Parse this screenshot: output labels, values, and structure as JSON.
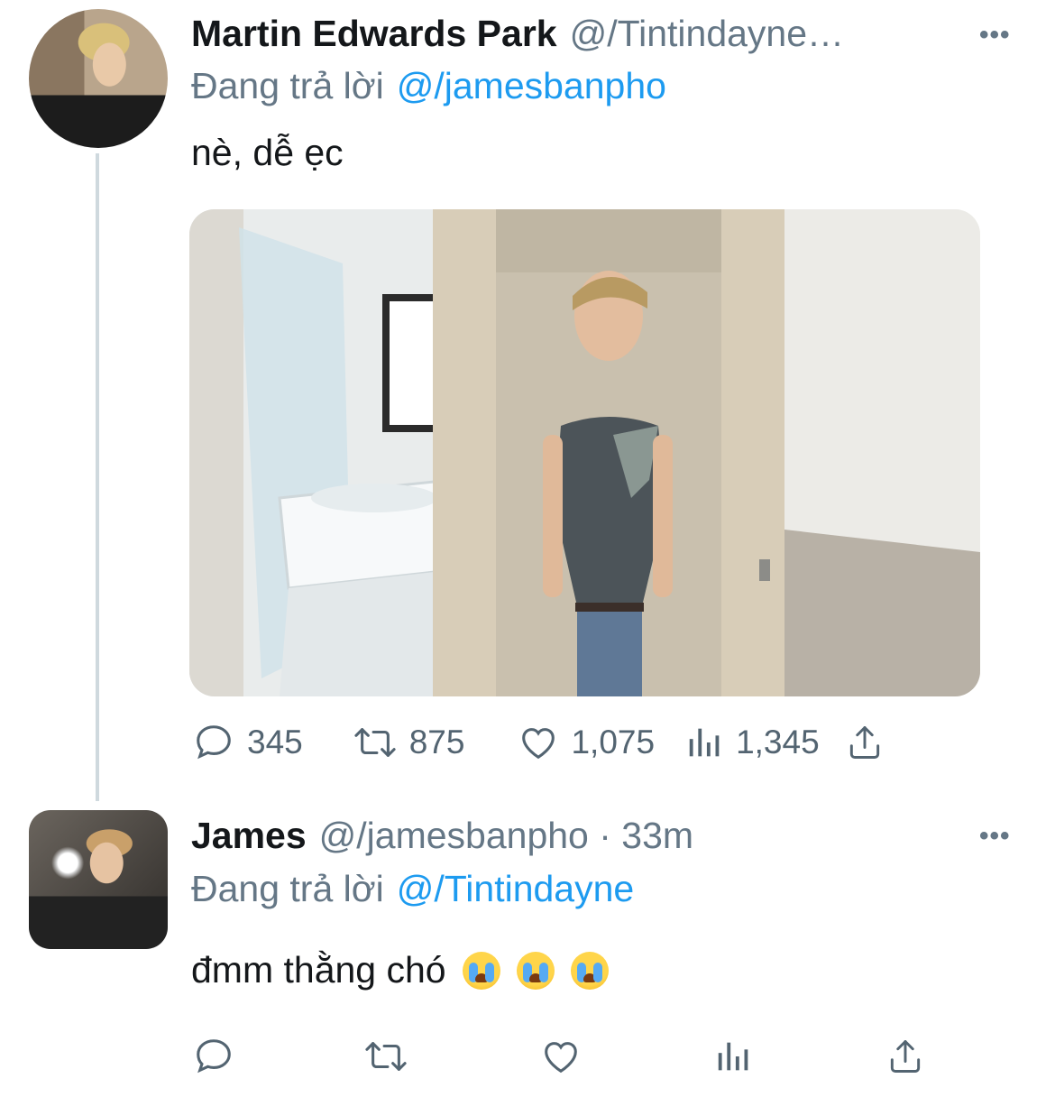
{
  "tweets": [
    {
      "name": "Martin Edwards Park",
      "handle": "@/Tintindayne…",
      "reply_prefix": "Đang trả lời",
      "reply_to": "@/jamesbanpho",
      "text": "nè, dễ ẹc",
      "more_icon": "•••",
      "stats": {
        "replies": "345",
        "retweets": "875",
        "likes": "1,075",
        "views": "1,345"
      }
    },
    {
      "name": "James",
      "handle": "@/jamesbanpho · 33m",
      "reply_prefix": "Đang trả lời",
      "reply_to": "@/Tintindayne",
      "text": "đmm thằng chó",
      "more_icon": "•••",
      "emojis": [
        "loudly-crying-face",
        "loudly-crying-face",
        "loudly-crying-face"
      ]
    }
  ],
  "colors": {
    "accent": "#1d9bf0",
    "secondary_text": "#657786",
    "primary_text": "#14171a",
    "thread_line": "#cfd9de"
  },
  "icons": [
    "reply-icon",
    "retweet-icon",
    "like-icon",
    "views-icon",
    "share-icon",
    "more-icon"
  ]
}
